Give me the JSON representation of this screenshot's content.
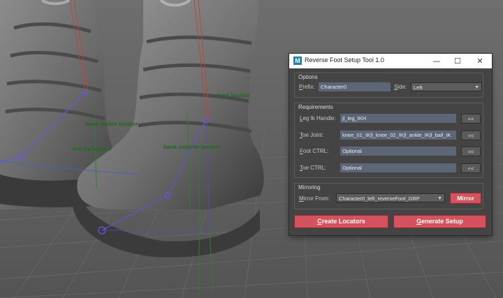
{
  "viewport": {
    "labels": {
      "heel_locator": "heel locator",
      "bank_inside_locator": "bank inside locator",
      "toe_tip_locator": "toe tip locator",
      "bank_outside_locator": "bank outside locator"
    }
  },
  "window": {
    "title": "Reverse Foot Setup Tool 1.0",
    "icon": "maya-icon",
    "buttons": {
      "minimize": "—",
      "maximize": "☐",
      "close": "✕"
    }
  },
  "options": {
    "title": "Options",
    "prefix_label": "Prefix:",
    "prefix_value": "Character0",
    "side_label": "Side:",
    "side_value": "Left"
  },
  "requirements": {
    "title": "Requirements",
    "rows": [
      {
        "label": "Leg Ik Handle:",
        "value": "jl_leg_IKH",
        "pick": "<<"
      },
      {
        "label": "Toe Joint:",
        "value": "knee_01_IK|l_knee_02_IK|l_ankle_IK|l_ball_IK",
        "pick": "<<"
      },
      {
        "label": "Foot CTRL:",
        "value": "Optional",
        "pick": "<<"
      },
      {
        "label": "Toe CTRL:",
        "value": "Optional",
        "pick": "<<"
      }
    ]
  },
  "mirroring": {
    "title": "Mirroring",
    "from_label": "Mirror From:",
    "from_value": "Character0_left_reverseFoot_GRP",
    "mirror_button": "Mirror"
  },
  "actions": {
    "create_locators": "Create Locators",
    "generate_setup": "Generate Setup"
  },
  "colors": {
    "accent_red": "#d4525e",
    "field_blue": "#5d6677",
    "panel_bg": "#444444",
    "locator_green": "#1f6b1f"
  }
}
